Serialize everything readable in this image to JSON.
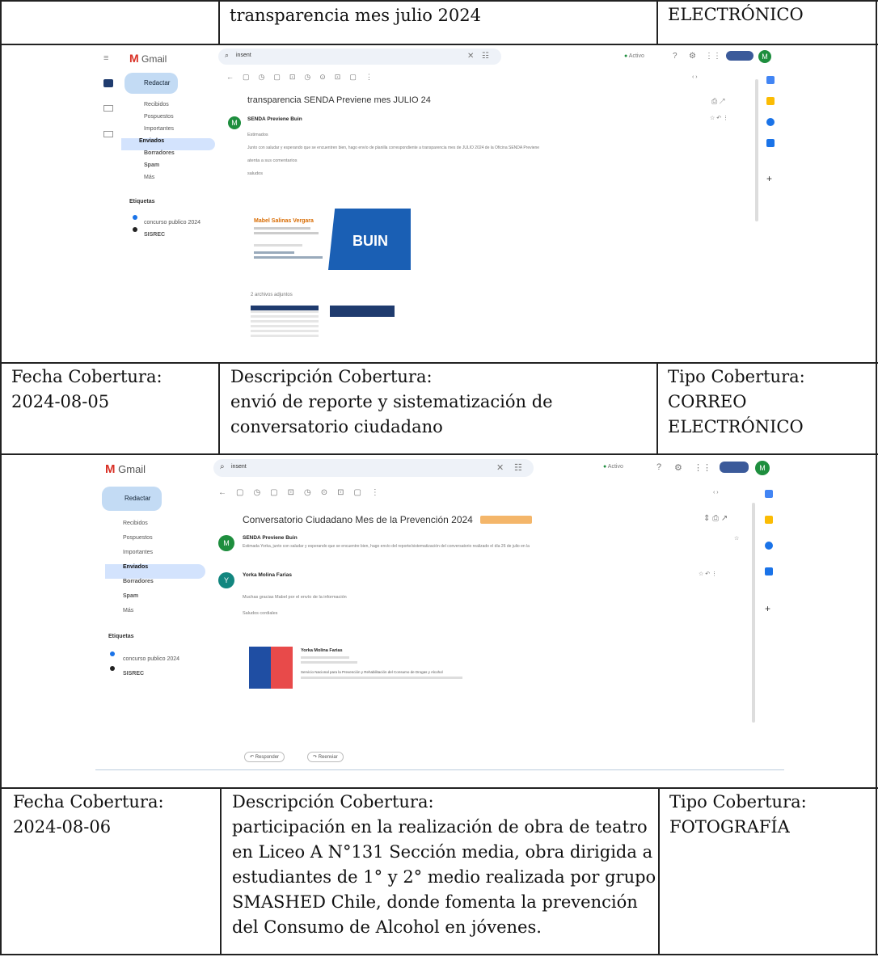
{
  "row0": {
    "description": "transparencia mes julio 2024",
    "type": "ELECTRÓNICO"
  },
  "row2": {
    "date_label": "Fecha Cobertura:",
    "date_value": "2024-08-05",
    "desc_label": "Descripción Cobertura:",
    "desc_lines": [
      "envió de reporte y sistematización de",
      "conversatorio ciudadano"
    ],
    "type_label": "Tipo Cobertura:",
    "type_lines": [
      "CORREO",
      "ELECTRÓNICO"
    ]
  },
  "row4": {
    "date_label": "Fecha Cobertura:",
    "date_value": "2024-08-06",
    "desc_label": "Descripción Cobertura:",
    "desc_lines": [
      "participación en la realización de obra de teatro",
      "en Liceo A N°131 Sección media, obra dirigida a",
      "estudiantes de 1° y 2° medio realizada por grupo",
      "SMASHED Chile, donde fomenta la prevención",
      "del Consumo de Alcohol en jóvenes."
    ],
    "type_label": "Tipo Cobertura:",
    "type_value": "FOTOGRAFÍA"
  },
  "gmail1": {
    "app": "Gmail",
    "search": "insent",
    "status": "Activo",
    "compose": "Redactar",
    "nav": [
      "Recibidos",
      "Pospuestos",
      "Importantes",
      "Enviados",
      "Borradores",
      "Spam",
      "Más"
    ],
    "labels_title": "Etiquetas",
    "labels": [
      "concurso publico 2024",
      "SISREC"
    ],
    "subject": "transparencia SENDA Previene mes JULIO 24",
    "sender": "SENDA Previene Buin",
    "body_greeting": "Estimados",
    "body_line": "Junto con saludar y esperando que se encuentren bien, hago envío de planilla correspondiente a transparencia mes de JULIO 2024 de la Oficina SENDA Previene",
    "body_attention": "atenta a sus comentarios",
    "body_closing": "saludos",
    "signature_name": "Mabel Salinas Vergara",
    "logo_text": "BUIN",
    "attachments": "2 archivos adjuntos"
  },
  "gmail2": {
    "app": "Gmail",
    "search": "insent",
    "status": "Activo",
    "compose": "Redactar",
    "nav": [
      "Recibidos",
      "Pospuestos",
      "Importantes",
      "Enviados",
      "Borradores",
      "Spam",
      "Más"
    ],
    "labels_title": "Etiquetas",
    "labels": [
      "concurso publico 2024",
      "SISREC"
    ],
    "subject": "Conversatorio Ciudadano Mes de la Prevención 2024",
    "sender1": "SENDA Previene Buin",
    "sender1_line": "Estimada Yorka, junto con saludar y esperando que se encuentre bien, hago envío del reporte/sistematización del conversatorio realizado el día 26 de julio en la",
    "sender2": "Yorka Molina Farias",
    "sender2_avatar": "Y",
    "reply_line": "Muchas gracias Mabel por el envío de la información",
    "reply_closing": "Saludos cordiales",
    "signature_name": "Yorka Molina Farias",
    "signature_org": "Servicio Nacional para la Prevención y Rehabilitación del Consumo de Drogas y Alcohol",
    "reply_button": "Responder",
    "forward_button": "Reenviar"
  },
  "avatar_letter": "M",
  "colors": {
    "gmail_red": "#d93025",
    "avatar_green": "#1e8e3e",
    "selected_nav": "#d3e3fd",
    "buin_blue": "#1a5fb4"
  }
}
